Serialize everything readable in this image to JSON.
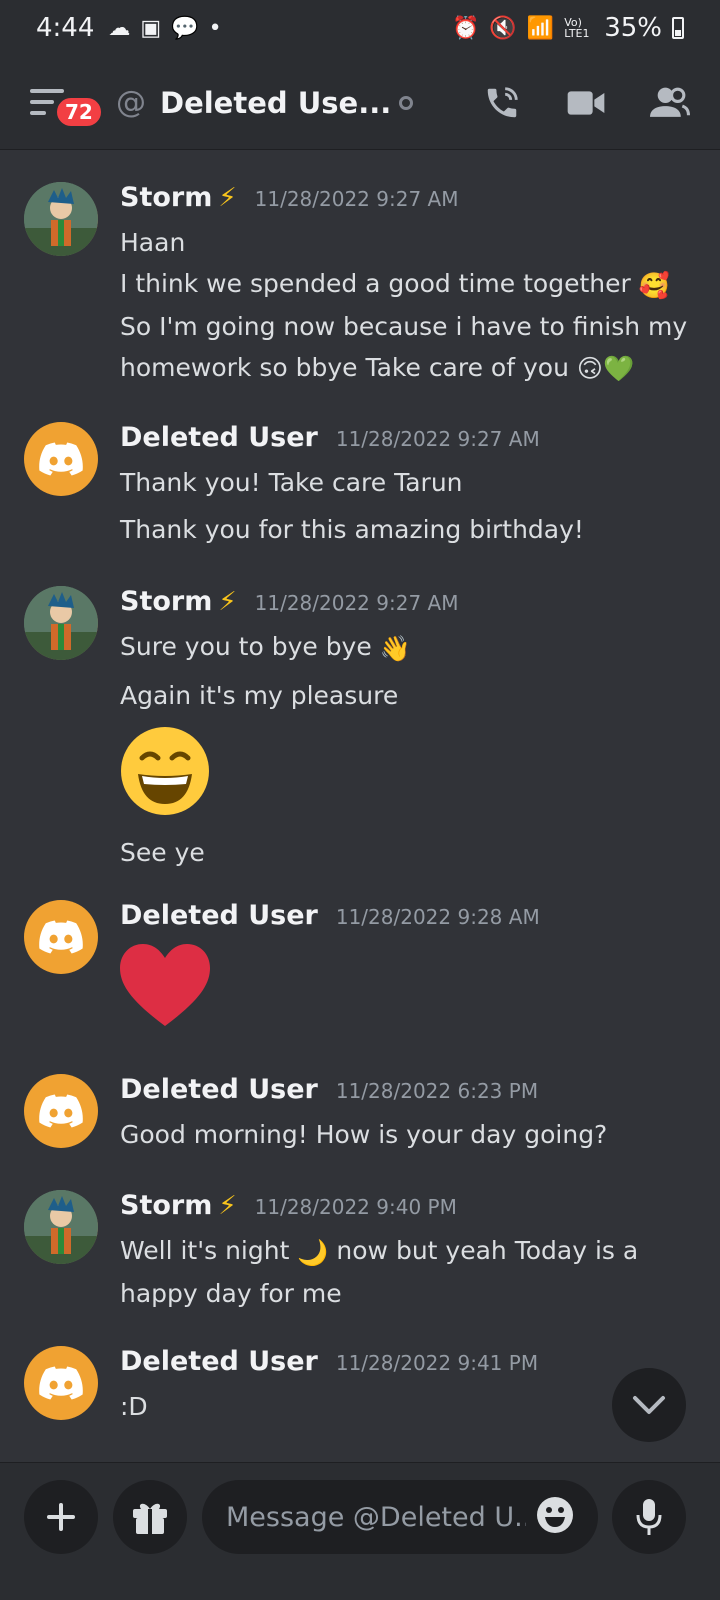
{
  "statusbar": {
    "time": "4:44",
    "battery": "35%",
    "network": "Vo) LTE1"
  },
  "header": {
    "badge_count": "72",
    "channel_title": "Deleted Use..."
  },
  "messages": [
    {
      "author": "Storm",
      "timestamp": "11/28/2022 9:27 AM",
      "lines": [
        "Haan",
        "I think we spended a good time together",
        "So I'm going now because i have to finish my",
        "homework so bbye Take care of you"
      ]
    },
    {
      "author": "Deleted User",
      "timestamp": "11/28/2022 9:27 AM",
      "lines": [
        "Thank you! Take care Tarun",
        "Thank you for this amazing birthday!"
      ]
    },
    {
      "author": "Storm",
      "timestamp": "11/28/2022 9:27 AM",
      "lines": [
        "Sure you to bye bye",
        "Again it's my pleasure",
        "See ye"
      ]
    },
    {
      "author": "Deleted User",
      "timestamp": "11/28/2022 9:28 AM",
      "lines": []
    },
    {
      "author": "Deleted User",
      "timestamp": "11/28/2022 6:23 PM",
      "lines": [
        "Good morning! How is your day going?"
      ]
    },
    {
      "author": "Storm",
      "timestamp": "11/28/2022 9:40 PM",
      "lines": [
        "Well it's night",
        "now but yeah Today is a",
        "happy day for me"
      ]
    },
    {
      "author": "Deleted User",
      "timestamp": "11/28/2022 9:41 PM",
      "lines": [
        ":D"
      ]
    }
  ],
  "composer": {
    "placeholder": "Message @Deleted U..."
  },
  "colors": {
    "background": "#313338",
    "header": "#2b2d31",
    "discord_avatar": "#f0a232",
    "badge": "#f23f43"
  }
}
